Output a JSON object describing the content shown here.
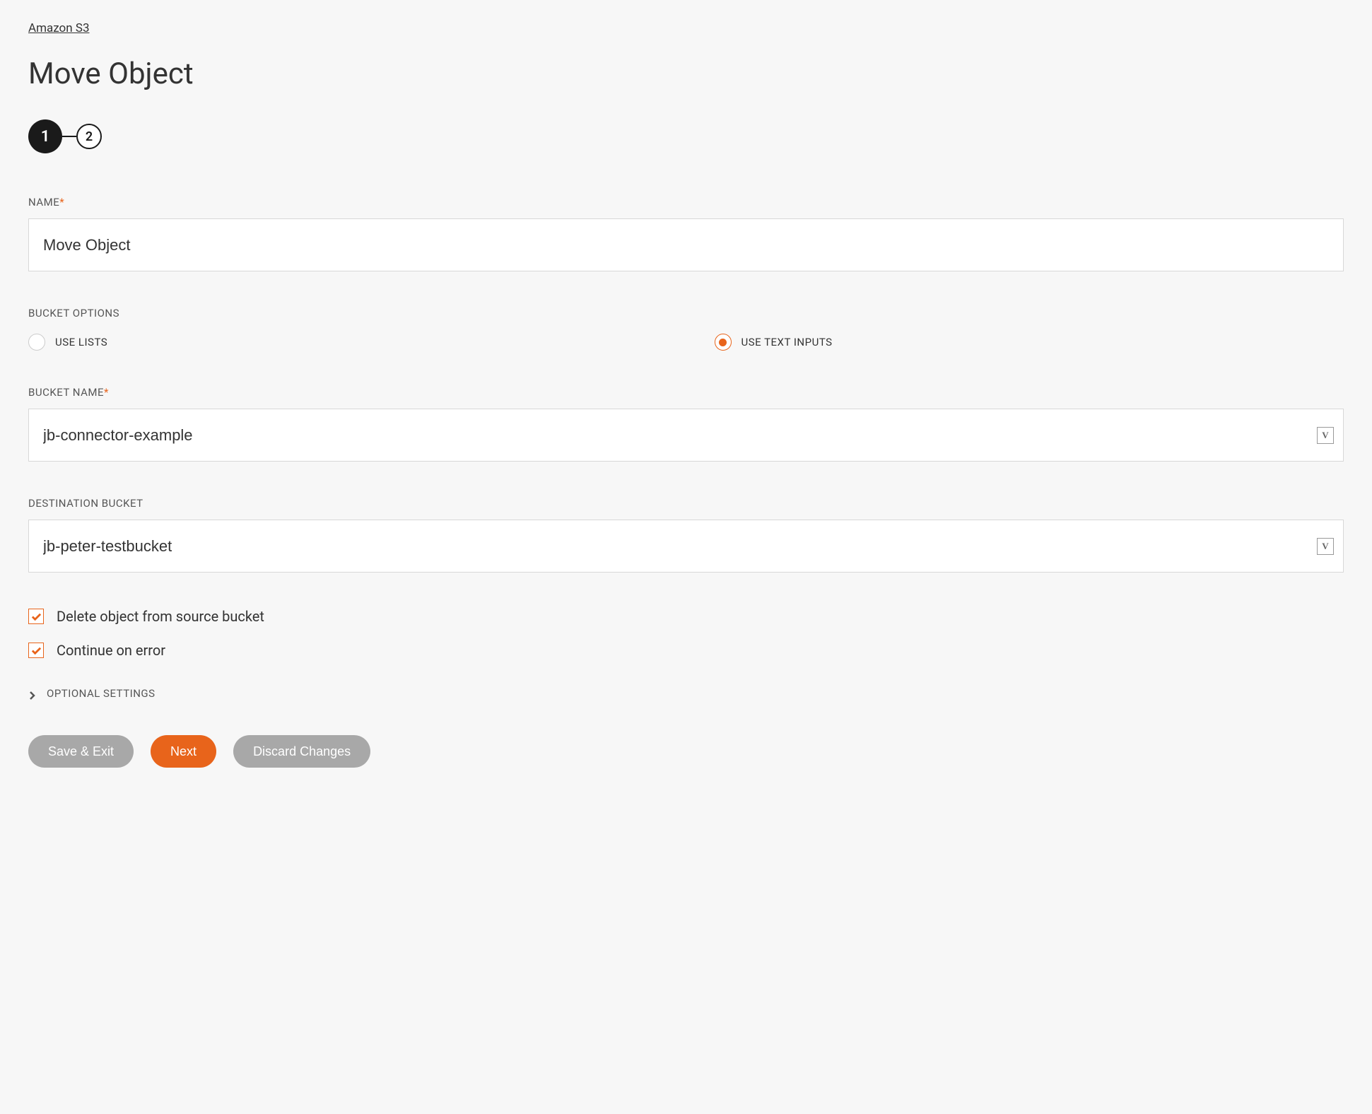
{
  "breadcrumb": "Amazon S3",
  "page_title": "Move Object",
  "stepper": {
    "step1": "1",
    "step2": "2"
  },
  "fields": {
    "name": {
      "label": "NAME",
      "value": "Move Object"
    },
    "bucket_options": {
      "label": "BUCKET OPTIONS",
      "use_lists": "USE LISTS",
      "use_text_inputs": "USE TEXT INPUTS"
    },
    "bucket_name": {
      "label": "BUCKET NAME",
      "value": "jb-connector-example"
    },
    "destination_bucket": {
      "label": "DESTINATION BUCKET",
      "value": "jb-peter-testbucket"
    }
  },
  "checkboxes": {
    "delete_source": "Delete object from source bucket",
    "continue_on_error": "Continue on error"
  },
  "optional_settings": "OPTIONAL SETTINGS",
  "buttons": {
    "save_exit": "Save & Exit",
    "next": "Next",
    "discard": "Discard Changes"
  }
}
